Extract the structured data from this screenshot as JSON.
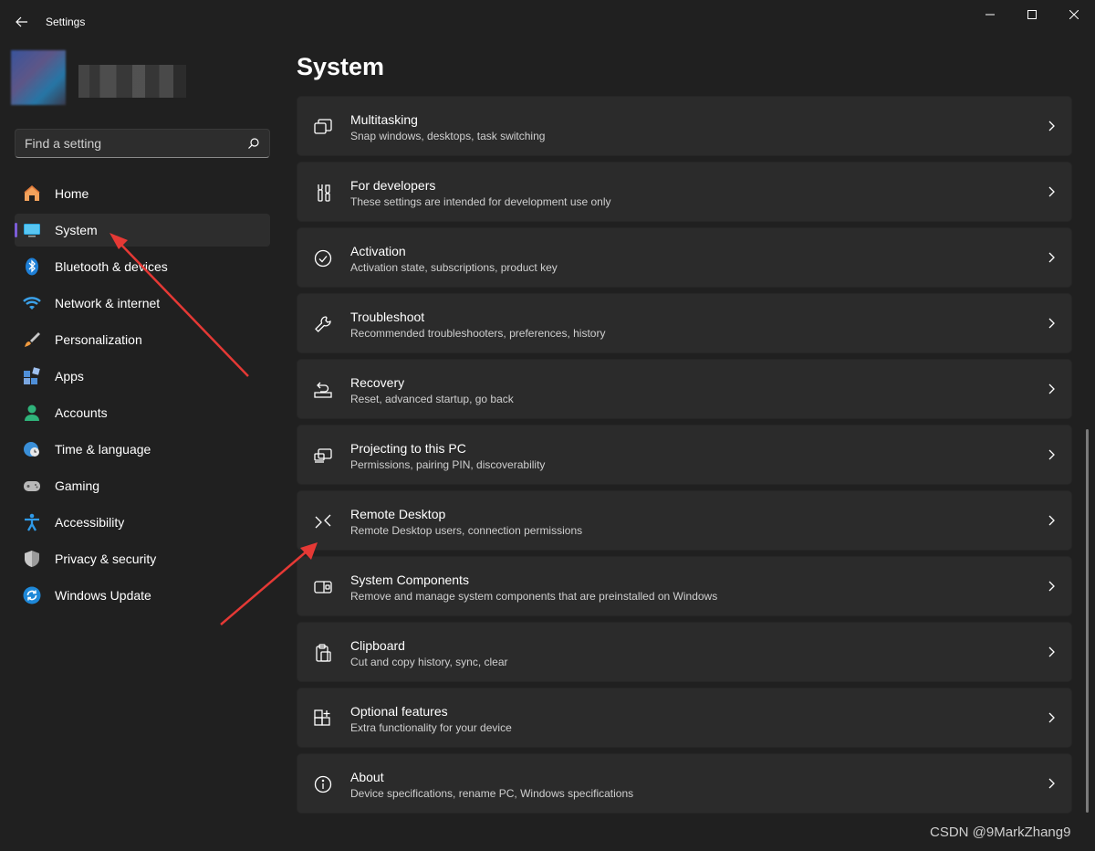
{
  "window": {
    "title": "Settings"
  },
  "search": {
    "placeholder": "Find a setting"
  },
  "sidebar": {
    "items": [
      {
        "label": "Home",
        "icon": "home-icon"
      },
      {
        "label": "System",
        "icon": "monitor-icon",
        "active": true
      },
      {
        "label": "Bluetooth & devices",
        "icon": "bluetooth-icon"
      },
      {
        "label": "Network & internet",
        "icon": "wifi-icon"
      },
      {
        "label": "Personalization",
        "icon": "brush-icon"
      },
      {
        "label": "Apps",
        "icon": "apps-icon"
      },
      {
        "label": "Accounts",
        "icon": "person-icon"
      },
      {
        "label": "Time & language",
        "icon": "globe-clock-icon"
      },
      {
        "label": "Gaming",
        "icon": "gamepad-icon"
      },
      {
        "label": "Accessibility",
        "icon": "accessibility-icon"
      },
      {
        "label": "Privacy & security",
        "icon": "shield-icon"
      },
      {
        "label": "Windows Update",
        "icon": "update-icon"
      }
    ]
  },
  "main": {
    "title": "System",
    "cards": [
      {
        "title": "Multitasking",
        "desc": "Snap windows, desktops, task switching",
        "icon": "multitasking-icon"
      },
      {
        "title": "For developers",
        "desc": "These settings are intended for development use only",
        "icon": "developer-tools-icon"
      },
      {
        "title": "Activation",
        "desc": "Activation state, subscriptions, product key",
        "icon": "check-circle-icon"
      },
      {
        "title": "Troubleshoot",
        "desc": "Recommended troubleshooters, preferences, history",
        "icon": "wrench-icon"
      },
      {
        "title": "Recovery",
        "desc": "Reset, advanced startup, go back",
        "icon": "recovery-icon"
      },
      {
        "title": "Projecting to this PC",
        "desc": "Permissions, pairing PIN, discoverability",
        "icon": "projecting-icon"
      },
      {
        "title": "Remote Desktop",
        "desc": "Remote Desktop users, connection permissions",
        "icon": "remote-desktop-icon"
      },
      {
        "title": "System Components",
        "desc": "Remove and manage system components that are preinstalled on Windows",
        "icon": "system-components-icon"
      },
      {
        "title": "Clipboard",
        "desc": "Cut and copy history, sync, clear",
        "icon": "clipboard-icon"
      },
      {
        "title": "Optional features",
        "desc": "Extra functionality for your device",
        "icon": "optional-features-icon"
      },
      {
        "title": "About",
        "desc": "Device specifications, rename PC, Windows specifications",
        "icon": "info-icon"
      }
    ]
  },
  "watermark": "CSDN @9MarkZhang9",
  "colors": {
    "background": "#202020",
    "card": "#2b2b2b",
    "accent": "#7b5cd6",
    "annotation": "#e53935"
  }
}
